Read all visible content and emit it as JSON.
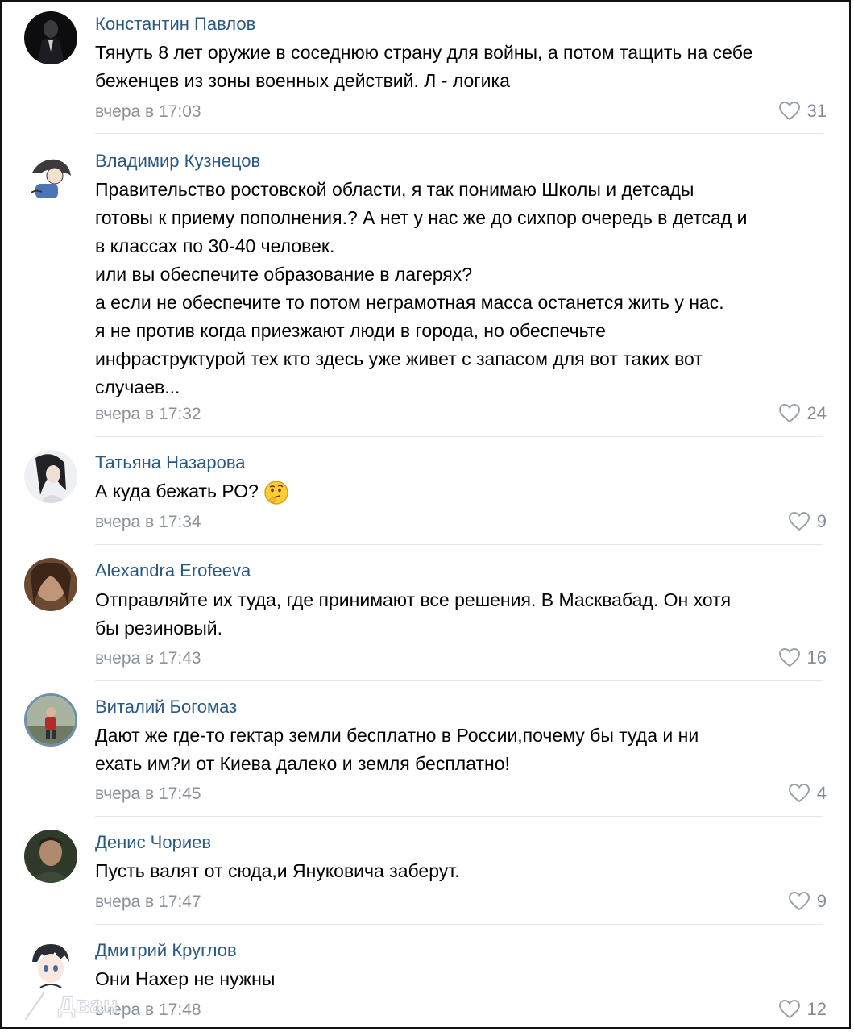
{
  "comments": [
    {
      "author": "Константин Павлов",
      "lines": [
        "Тянуть 8 лет оружие в соседнюю страну для войны, а потом тащить на себе",
        "беженцев из зоны военных действий. Л - логика"
      ],
      "date": "вчера в 17:03",
      "likes": "31"
    },
    {
      "author": "Владимир Кузнецов",
      "lines": [
        "Правительство ростовской области, я так понимаю Школы и детсады",
        "готовы к приему пополнения.? А нет у нас же до сихпор очередь в детсад и",
        "в классах по 30-40 человек.",
        "или вы обеспечите образование в лагерях?",
        "а если не обеспечите то потом неграмотная масса останется жить у нас.",
        "я не против когда приезжают люди в города, но обеспечьте",
        "инфраструктурой тех кто здесь уже живет с запасом для вот таких вот",
        "случаев..."
      ],
      "date": "вчера в 17:32",
      "likes": "24"
    },
    {
      "author": "Татьяна Назарова",
      "lines": [
        "А куда бежать РО?"
      ],
      "date": "вчера в 17:34",
      "likes": "9",
      "emoji": "thinking-face-icon"
    },
    {
      "author": "Alexandra Erofeeva",
      "lines": [
        "Отправляйте их туда, где принимают все решения. В Масквабад. Он хотя",
        "бы резиновый."
      ],
      "date": "вчера в 17:43",
      "likes": "16"
    },
    {
      "author": "Виталий Богомаз",
      "lines": [
        "Дают же где-то гектар земли бесплатно в России,почему бы туда и ни",
        "ехать им?и от Киева далеко и земля бесплатно!"
      ],
      "date": "вчера в 17:45",
      "likes": "4"
    },
    {
      "author": "Денис Чориев",
      "lines": [
        "Пусть валят от сюда,и Януковича заберут."
      ],
      "date": "вчера в 17:47",
      "likes": "9"
    },
    {
      "author": "Дмитрий Круглов",
      "lines": [
        "Они Нахер не нужны"
      ],
      "date": "вчера в 17:48",
      "likes": "12"
    }
  ],
  "watermark": "Дван",
  "colors": {
    "author": "#2a5885",
    "date": "#8a9299",
    "likes": "#818c99",
    "divider": "#e3e6ea"
  }
}
